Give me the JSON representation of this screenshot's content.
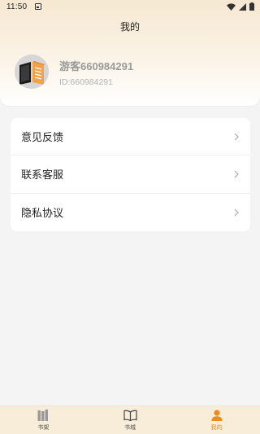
{
  "status_bar": {
    "time": "11:50"
  },
  "header": {
    "title": "我的"
  },
  "profile": {
    "username": "游客660984291",
    "user_id": "ID:660984291"
  },
  "menu": {
    "items": [
      {
        "label": "意见反馈"
      },
      {
        "label": "联系客服"
      },
      {
        "label": "隐私协议"
      }
    ]
  },
  "tabbar": {
    "tabs": [
      {
        "label": "书架",
        "icon": "bookshelf-icon",
        "active": false
      },
      {
        "label": "书城",
        "icon": "open-book-icon",
        "active": false
      },
      {
        "label": "我的",
        "icon": "person-icon",
        "active": true
      }
    ],
    "active_color": "#f08a1c",
    "inactive_color": "#555555"
  },
  "colors": {
    "header_gradient_top": "#f6e8d2",
    "page_background": "#f4f4f4",
    "tabbar_background": "#f8edd9"
  }
}
